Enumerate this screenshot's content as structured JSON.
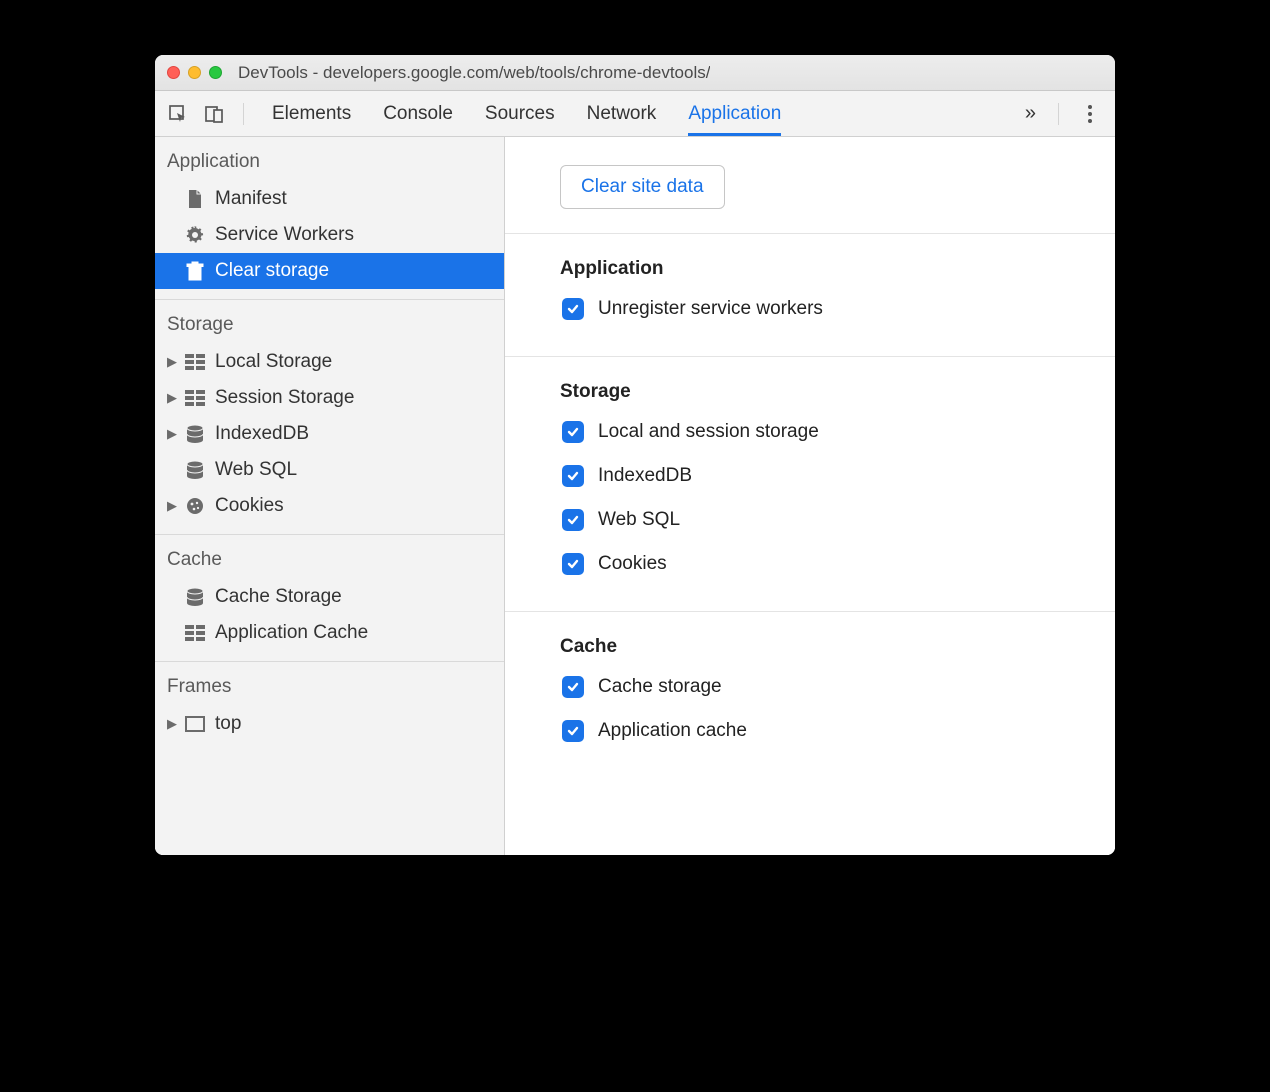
{
  "window": {
    "title": "DevTools - developers.google.com/web/tools/chrome-devtools/"
  },
  "tabs": {
    "items": [
      "Elements",
      "Console",
      "Sources",
      "Network",
      "Application"
    ],
    "active": "Application"
  },
  "sidebar": {
    "sections": [
      {
        "title": "Application",
        "items": [
          {
            "label": "Manifest",
            "icon": "file",
            "expandable": false,
            "selected": false
          },
          {
            "label": "Service Workers",
            "icon": "gear",
            "expandable": false,
            "selected": false
          },
          {
            "label": "Clear storage",
            "icon": "trash",
            "expandable": false,
            "selected": true
          }
        ]
      },
      {
        "title": "Storage",
        "items": [
          {
            "label": "Local Storage",
            "icon": "grid",
            "expandable": true,
            "selected": false
          },
          {
            "label": "Session Storage",
            "icon": "grid",
            "expandable": true,
            "selected": false
          },
          {
            "label": "IndexedDB",
            "icon": "db",
            "expandable": true,
            "selected": false
          },
          {
            "label": "Web SQL",
            "icon": "db",
            "expandable": false,
            "selected": false
          },
          {
            "label": "Cookies",
            "icon": "cookie",
            "expandable": true,
            "selected": false
          }
        ]
      },
      {
        "title": "Cache",
        "items": [
          {
            "label": "Cache Storage",
            "icon": "db",
            "expandable": false,
            "selected": false
          },
          {
            "label": "Application Cache",
            "icon": "grid",
            "expandable": false,
            "selected": false
          }
        ]
      },
      {
        "title": "Frames",
        "items": [
          {
            "label": "top",
            "icon": "frame",
            "expandable": true,
            "selected": false
          }
        ]
      }
    ]
  },
  "main": {
    "clear_button": "Clear site data",
    "groups": [
      {
        "title": "Application",
        "checks": [
          {
            "label": "Unregister service workers",
            "checked": true
          }
        ]
      },
      {
        "title": "Storage",
        "checks": [
          {
            "label": "Local and session storage",
            "checked": true
          },
          {
            "label": "IndexedDB",
            "checked": true
          },
          {
            "label": "Web SQL",
            "checked": true
          },
          {
            "label": "Cookies",
            "checked": true
          }
        ]
      },
      {
        "title": "Cache",
        "checks": [
          {
            "label": "Cache storage",
            "checked": true
          },
          {
            "label": "Application cache",
            "checked": true
          }
        ]
      }
    ]
  }
}
